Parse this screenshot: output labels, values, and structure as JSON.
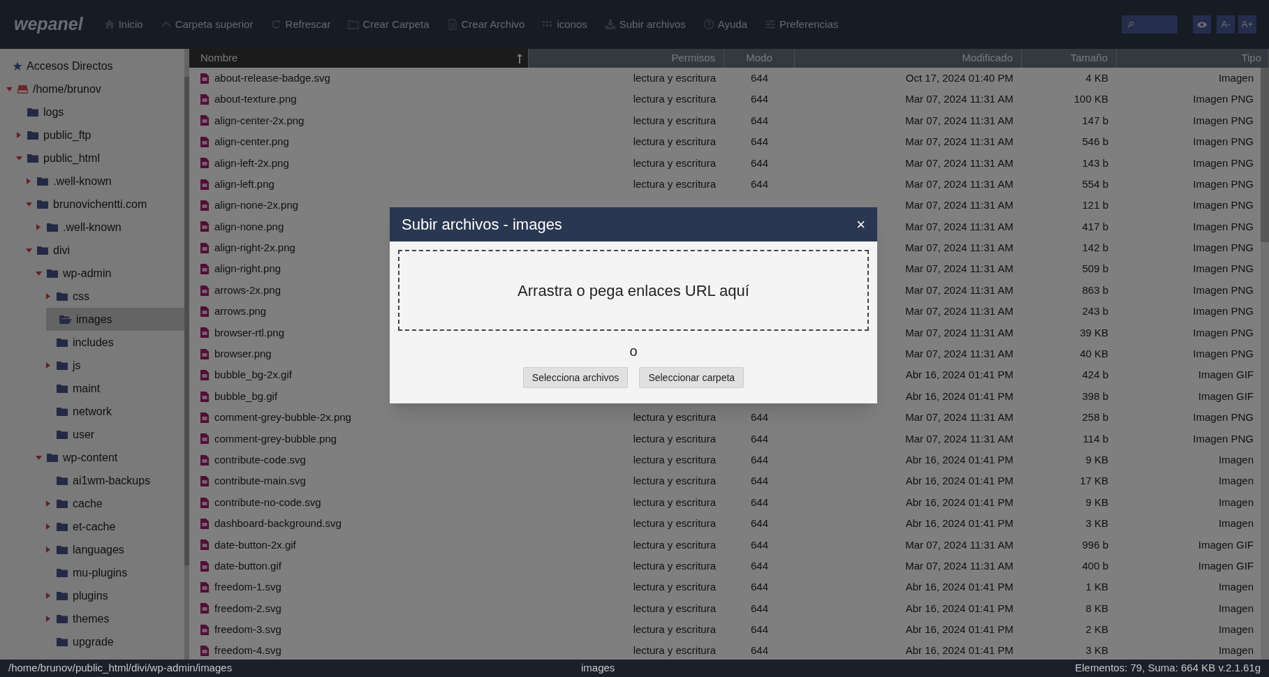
{
  "app": {
    "logo": "wepanel"
  },
  "toolbar": [
    {
      "kind": "home",
      "label": "Inicio"
    },
    {
      "kind": "up",
      "label": "Carpeta superior"
    },
    {
      "kind": "refresh",
      "label": "Refrescar"
    },
    {
      "kind": "folder",
      "label": "Crear Carpeta"
    },
    {
      "kind": "file",
      "label": "Crear Archivo"
    },
    {
      "kind": "grid",
      "label": "iconos"
    },
    {
      "kind": "upload",
      "label": "Subir archivos"
    },
    {
      "kind": "help",
      "label": "Ayuda"
    },
    {
      "kind": "sliders",
      "label": "Preferencias"
    }
  ],
  "font_buttons": [
    "A-",
    "A+"
  ],
  "sidebar": {
    "shortcuts": "Accesos Directos",
    "tree": [
      {
        "label": "/home/brunov",
        "kind": "drive",
        "expanded": true,
        "selected": false,
        "children": [
          {
            "label": "logs",
            "kind": "folder",
            "selected": false
          },
          {
            "label": "public_ftp",
            "kind": "folder",
            "expanded": false,
            "selected": false
          },
          {
            "label": "public_html",
            "kind": "folder",
            "expanded": true,
            "selected": false,
            "children": [
              {
                "label": ".well-known",
                "kind": "folder",
                "expanded": false,
                "selected": false
              },
              {
                "label": "brunovichentti.com",
                "kind": "folder",
                "expanded": true,
                "selected": false,
                "children": [
                  {
                    "label": ".well-known",
                    "kind": "folder",
                    "expanded": false,
                    "selected": false
                  }
                ]
              },
              {
                "label": "divi",
                "kind": "folder",
                "expanded": true,
                "selected": false,
                "children": [
                  {
                    "label": "wp-admin",
                    "kind": "folder",
                    "expanded": true,
                    "selected": false,
                    "children": [
                      {
                        "label": "css",
                        "kind": "folder",
                        "expanded": false,
                        "selected": false
                      },
                      {
                        "label": "images",
                        "kind": "folder",
                        "selected": true
                      },
                      {
                        "label": "includes",
                        "kind": "folder",
                        "selected": false
                      },
                      {
                        "label": "js",
                        "kind": "folder",
                        "expanded": false,
                        "selected": false
                      },
                      {
                        "label": "maint",
                        "kind": "folder",
                        "selected": false
                      },
                      {
                        "label": "network",
                        "kind": "folder",
                        "selected": false
                      },
                      {
                        "label": "user",
                        "kind": "folder",
                        "selected": false
                      }
                    ]
                  },
                  {
                    "label": "wp-content",
                    "kind": "folder",
                    "expanded": true,
                    "selected": false,
                    "children": [
                      {
                        "label": "ai1wm-backups",
                        "kind": "folder",
                        "selected": false
                      },
                      {
                        "label": "cache",
                        "kind": "folder",
                        "expanded": false,
                        "selected": false
                      },
                      {
                        "label": "et-cache",
                        "kind": "folder",
                        "expanded": false,
                        "selected": false
                      },
                      {
                        "label": "languages",
                        "kind": "folder",
                        "expanded": false,
                        "selected": false
                      },
                      {
                        "label": "mu-plugins",
                        "kind": "folder",
                        "selected": false
                      },
                      {
                        "label": "plugins",
                        "kind": "folder",
                        "expanded": false,
                        "selected": false
                      },
                      {
                        "label": "themes",
                        "kind": "folder",
                        "expanded": false,
                        "selected": false
                      },
                      {
                        "label": "upgrade",
                        "kind": "folder",
                        "selected": false
                      }
                    ]
                  }
                ]
              }
            ]
          }
        ]
      }
    ]
  },
  "table": {
    "columns": [
      "Nombre",
      "Permisos",
      "Modo",
      "Modificado",
      "Tamaño",
      "Tipo"
    ],
    "rows": [
      {
        "name": "about-release-badge.svg",
        "permisos": "lectura y escritura",
        "modo": "644",
        "modificado": "Oct 17, 2024 01:40 PM",
        "tamano": "4 KB",
        "tipo": "Imagen"
      },
      {
        "name": "about-texture.png",
        "permisos": "lectura y escritura",
        "modo": "644",
        "modificado": "Mar 07, 2024 11:31 AM",
        "tamano": "100 KB",
        "tipo": "Imagen PNG"
      },
      {
        "name": "align-center-2x.png",
        "permisos": "lectura y escritura",
        "modo": "644",
        "modificado": "Mar 07, 2024 11:31 AM",
        "tamano": "147 b",
        "tipo": "Imagen PNG"
      },
      {
        "name": "align-center.png",
        "permisos": "lectura y escritura",
        "modo": "644",
        "modificado": "Mar 07, 2024 11:31 AM",
        "tamano": "546 b",
        "tipo": "Imagen PNG"
      },
      {
        "name": "align-left-2x.png",
        "permisos": "lectura y escritura",
        "modo": "644",
        "modificado": "Mar 07, 2024 11:31 AM",
        "tamano": "143 b",
        "tipo": "Imagen PNG"
      },
      {
        "name": "align-left.png",
        "permisos": "lectura y escritura",
        "modo": "644",
        "modificado": "Mar 07, 2024 11:31 AM",
        "tamano": "554 b",
        "tipo": "Imagen PNG"
      },
      {
        "name": "align-none-2x.png",
        "modificado": "Mar 07, 2024 11:31 AM",
        "tamano": "121 b",
        "tipo": "Imagen PNG"
      },
      {
        "name": "align-none.png",
        "modificado": "Mar 07, 2024 11:31 AM",
        "tamano": "417 b",
        "tipo": "Imagen PNG"
      },
      {
        "name": "align-right-2x.png",
        "modificado": "Mar 07, 2024 11:31 AM",
        "tamano": "142 b",
        "tipo": "Imagen PNG"
      },
      {
        "name": "align-right.png",
        "modificado": "Mar 07, 2024 11:31 AM",
        "tamano": "509 b",
        "tipo": "Imagen PNG"
      },
      {
        "name": "arrows-2x.png",
        "modificado": "Mar 07, 2024 11:31 AM",
        "tamano": "863 b",
        "tipo": "Imagen PNG"
      },
      {
        "name": "arrows.png",
        "modificado": "Mar 07, 2024 11:31 AM",
        "tamano": "243 b",
        "tipo": "Imagen PNG"
      },
      {
        "name": "browser-rtl.png",
        "modificado": "Mar 07, 2024 11:31 AM",
        "tamano": "39 KB",
        "tipo": "Imagen PNG"
      },
      {
        "name": "browser.png",
        "modificado": "Mar 07, 2024 11:31 AM",
        "tamano": "40 KB",
        "tipo": "Imagen PNG"
      },
      {
        "name": "bubble_bg-2x.gif",
        "modificado": "Abr 16, 2024 01:41 PM",
        "tamano": "424 b",
        "tipo": "Imagen GIF"
      },
      {
        "name": "bubble_bg.gif",
        "modificado": "Abr 16, 2024 01:41 PM",
        "tamano": "398 b",
        "tipo": "Imagen GIF"
      },
      {
        "name": "comment-grey-bubble-2x.png",
        "permisos": "lectura y escritura",
        "modo": "644",
        "modificado": "Mar 07, 2024 11:31 AM",
        "tamano": "258 b",
        "tipo": "Imagen PNG"
      },
      {
        "name": "comment-grey-bubble.png",
        "permisos": "lectura y escritura",
        "modo": "644",
        "modificado": "Mar 07, 2024 11:31 AM",
        "tamano": "114 b",
        "tipo": "Imagen PNG"
      },
      {
        "name": "contribute-code.svg",
        "permisos": "lectura y escritura",
        "modo": "644",
        "modificado": "Abr 16, 2024 01:41 PM",
        "tamano": "9 KB",
        "tipo": "Imagen"
      },
      {
        "name": "contribute-main.svg",
        "permisos": "lectura y escritura",
        "modo": "644",
        "modificado": "Abr 16, 2024 01:41 PM",
        "tamano": "17 KB",
        "tipo": "Imagen"
      },
      {
        "name": "contribute-no-code.svg",
        "permisos": "lectura y escritura",
        "modo": "644",
        "modificado": "Abr 16, 2024 01:41 PM",
        "tamano": "9 KB",
        "tipo": "Imagen"
      },
      {
        "name": "dashboard-background.svg",
        "permisos": "lectura y escritura",
        "modo": "644",
        "modificado": "Abr 16, 2024 01:41 PM",
        "tamano": "3 KB",
        "tipo": "Imagen"
      },
      {
        "name": "date-button-2x.gif",
        "permisos": "lectura y escritura",
        "modo": "644",
        "modificado": "Mar 07, 2024 11:31 AM",
        "tamano": "996 b",
        "tipo": "Imagen GIF"
      },
      {
        "name": "date-button.gif",
        "permisos": "lectura y escritura",
        "modo": "644",
        "modificado": "Mar 07, 2024 11:31 AM",
        "tamano": "400 b",
        "tipo": "Imagen GIF"
      },
      {
        "name": "freedom-1.svg",
        "permisos": "lectura y escritura",
        "modo": "644",
        "modificado": "Abr 16, 2024 01:41 PM",
        "tamano": "1 KB",
        "tipo": "Imagen"
      },
      {
        "name": "freedom-2.svg",
        "permisos": "lectura y escritura",
        "modo": "644",
        "modificado": "Abr 16, 2024 01:41 PM",
        "tamano": "8 KB",
        "tipo": "Imagen"
      },
      {
        "name": "freedom-3.svg",
        "permisos": "lectura y escritura",
        "modo": "644",
        "modificado": "Abr 16, 2024 01:41 PM",
        "tamano": "2 KB",
        "tipo": "Imagen"
      },
      {
        "name": "freedom-4.svg",
        "permisos": "lectura y escritura",
        "modo": "644",
        "modificado": "Abr 16, 2024 01:41 PM",
        "tamano": "3 KB",
        "tipo": "Imagen"
      }
    ]
  },
  "status_bar": {
    "path": "/home/brunov/public_html/divi/wp-admin/images",
    "folder": "images",
    "summary": "Elementos: 79, Suma: 664 KB v.2.1.61g"
  },
  "dialog": {
    "title": "Subir archivos - images",
    "close": "×",
    "dropzone": "Arrastra o pega enlaces URL aquí",
    "separator": "o",
    "buttons": [
      "Selecciona archivos",
      "Seleccionar carpeta"
    ]
  }
}
